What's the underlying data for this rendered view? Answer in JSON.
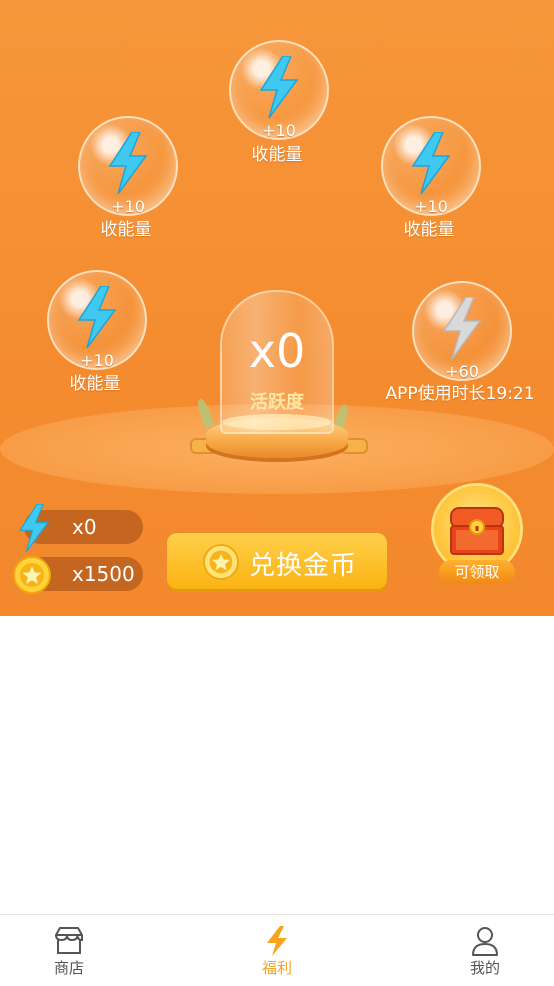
{
  "bubbles": [
    {
      "bonus": "+10",
      "label": "收能量",
      "state": "active"
    },
    {
      "bonus": "+10",
      "label": "收能量",
      "state": "active"
    },
    {
      "bonus": "+10",
      "label": "收能量",
      "state": "active"
    },
    {
      "bonus": "+10",
      "label": "收能量",
      "state": "active"
    },
    {
      "bonus": "+60",
      "label": "APP使用时长19:21",
      "state": "pending"
    }
  ],
  "dome": {
    "count": "x0",
    "label": "活跃度"
  },
  "stats": {
    "energy": "x0",
    "coins": "x1500"
  },
  "exchange_button": {
    "label": "兑换金币"
  },
  "chest": {
    "label": "可领取"
  },
  "tabbar": [
    {
      "label": "商店",
      "icon": "store-icon",
      "active": false
    },
    {
      "label": "福利",
      "icon": "lightning-icon",
      "active": true
    },
    {
      "label": "我的",
      "icon": "person-icon",
      "active": false
    }
  ],
  "colors": {
    "accent": "#f7963a",
    "active_tab": "#f9a21b",
    "inactive_tab": "#555555"
  }
}
